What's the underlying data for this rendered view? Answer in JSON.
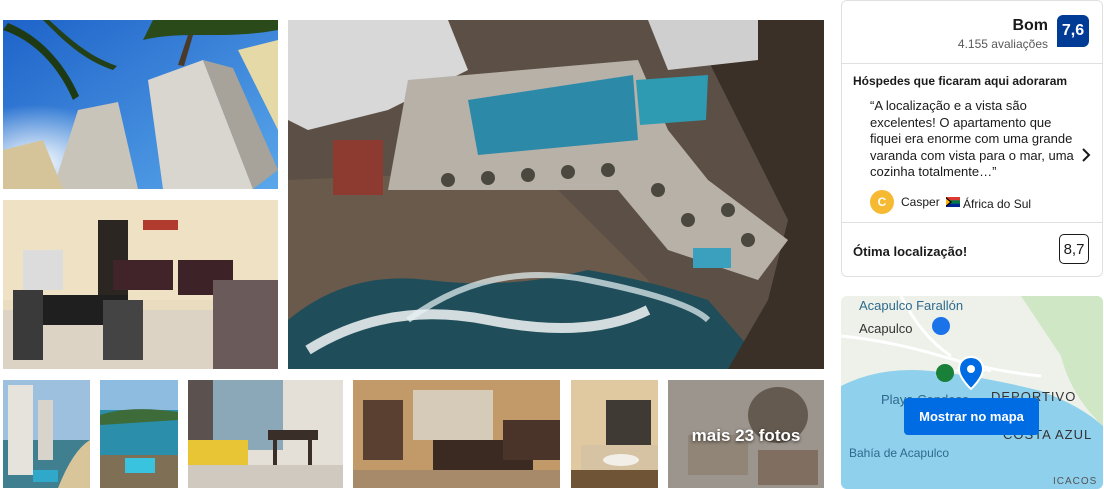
{
  "gallery": {
    "more_photos_label": "mais 23 fotos"
  },
  "review_summary": {
    "rating_word": "Bom",
    "review_count": "4.155 avaliações",
    "score": "7,6",
    "guests_loved_title": "Hóspedes que ficaram aqui adoraram",
    "quote": "“A localização e a vista são excelentes! O apartamento que fiquei era enorme com uma grande varanda com vista para o mar, uma cozinha totalmente…”",
    "reviewer_initial": "C",
    "reviewer_name": "Casper",
    "reviewer_country": "África do Sul",
    "location_label": "Ótima localização!",
    "location_score": "8,7"
  },
  "map": {
    "labels": {
      "farallon": "Acapulco Farallón",
      "acapulco": "Acapulco",
      "deportivo": "DEPORTIVO",
      "playa": "Playa Condesa",
      "costa_azul": "COSTA AZUL",
      "bahia": "Bahía de Acapulco",
      "icacos": "ICACOS"
    },
    "button_label": "Mostrar no mapa"
  },
  "colors": {
    "brand_blue": "#003b95",
    "button_blue": "#006ce4",
    "avatar_yellow": "#f5b932"
  },
  "icons": [
    "chevron-right-icon",
    "map-pin-icon",
    "flag-icon"
  ]
}
